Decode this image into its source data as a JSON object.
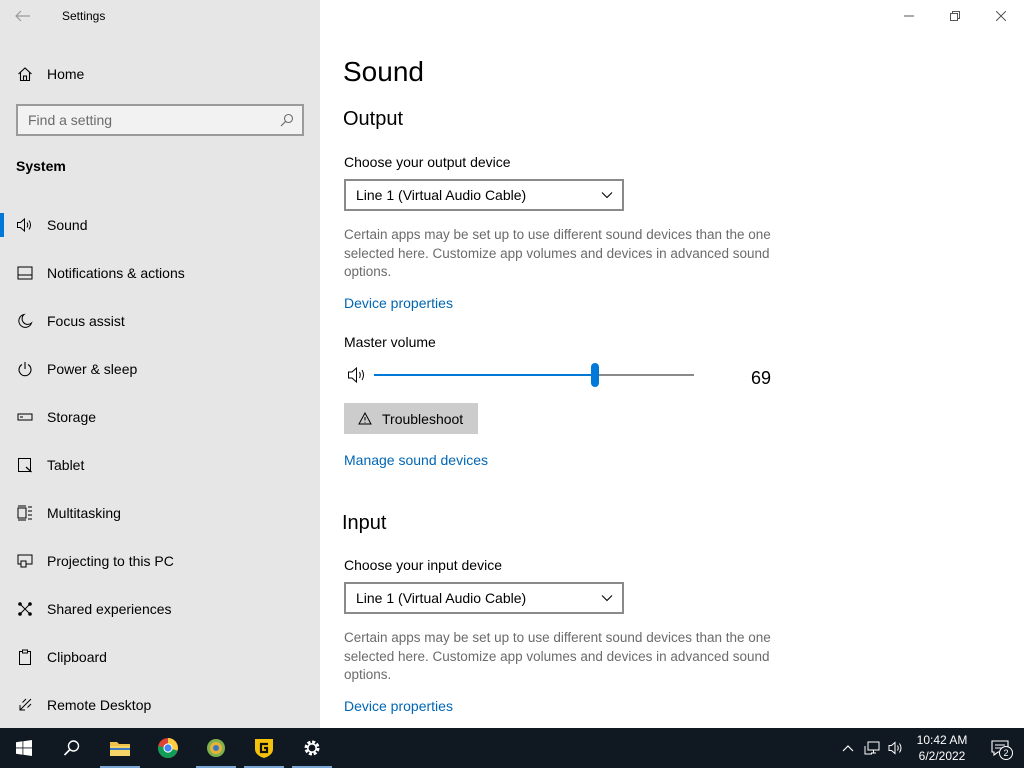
{
  "app": {
    "title": "Settings"
  },
  "sidebar": {
    "home_label": "Home",
    "search_placeholder": "Find a setting",
    "section_label": "System",
    "items": [
      {
        "label": "Sound",
        "icon": "speaker-icon",
        "active": true
      },
      {
        "label": "Notifications & actions",
        "icon": "notification-icon"
      },
      {
        "label": "Focus assist",
        "icon": "moon-icon"
      },
      {
        "label": "Power & sleep",
        "icon": "power-icon"
      },
      {
        "label": "Storage",
        "icon": "storage-icon"
      },
      {
        "label": "Tablet",
        "icon": "tablet-icon"
      },
      {
        "label": "Multitasking",
        "icon": "multitasking-icon"
      },
      {
        "label": "Projecting to this PC",
        "icon": "projecting-icon"
      },
      {
        "label": "Shared experiences",
        "icon": "shared-icon"
      },
      {
        "label": "Clipboard",
        "icon": "clipboard-icon"
      },
      {
        "label": "Remote Desktop",
        "icon": "remote-desktop-icon"
      }
    ]
  },
  "main": {
    "title": "Sound",
    "output": {
      "heading": "Output",
      "device_label": "Choose your output device",
      "device_value": "Line 1 (Virtual Audio Cable)",
      "description": "Certain apps may be set up to use different sound devices than the one selected here. Customize app volumes and devices in advanced sound options.",
      "device_properties_link": "Device properties",
      "master_volume_label": "Master volume",
      "volume": 69,
      "troubleshoot_label": "Troubleshoot",
      "manage_link": "Manage sound devices"
    },
    "input": {
      "heading": "Input",
      "device_label": "Choose your input device",
      "device_value": "Line 1 (Virtual Audio Cable)",
      "description": "Certain apps may be set up to use different sound devices than the one selected here. Customize app volumes and devices in advanced sound options.",
      "device_properties_link": "Device properties"
    }
  },
  "taskbar": {
    "time": "10:42 AM",
    "date": "6/2/2022",
    "notification_count": "2"
  },
  "colors": {
    "accent": "#0078d7",
    "link": "#0066b4",
    "sidebar_bg": "#e6e6e6",
    "taskbar_bg": "#101822"
  }
}
